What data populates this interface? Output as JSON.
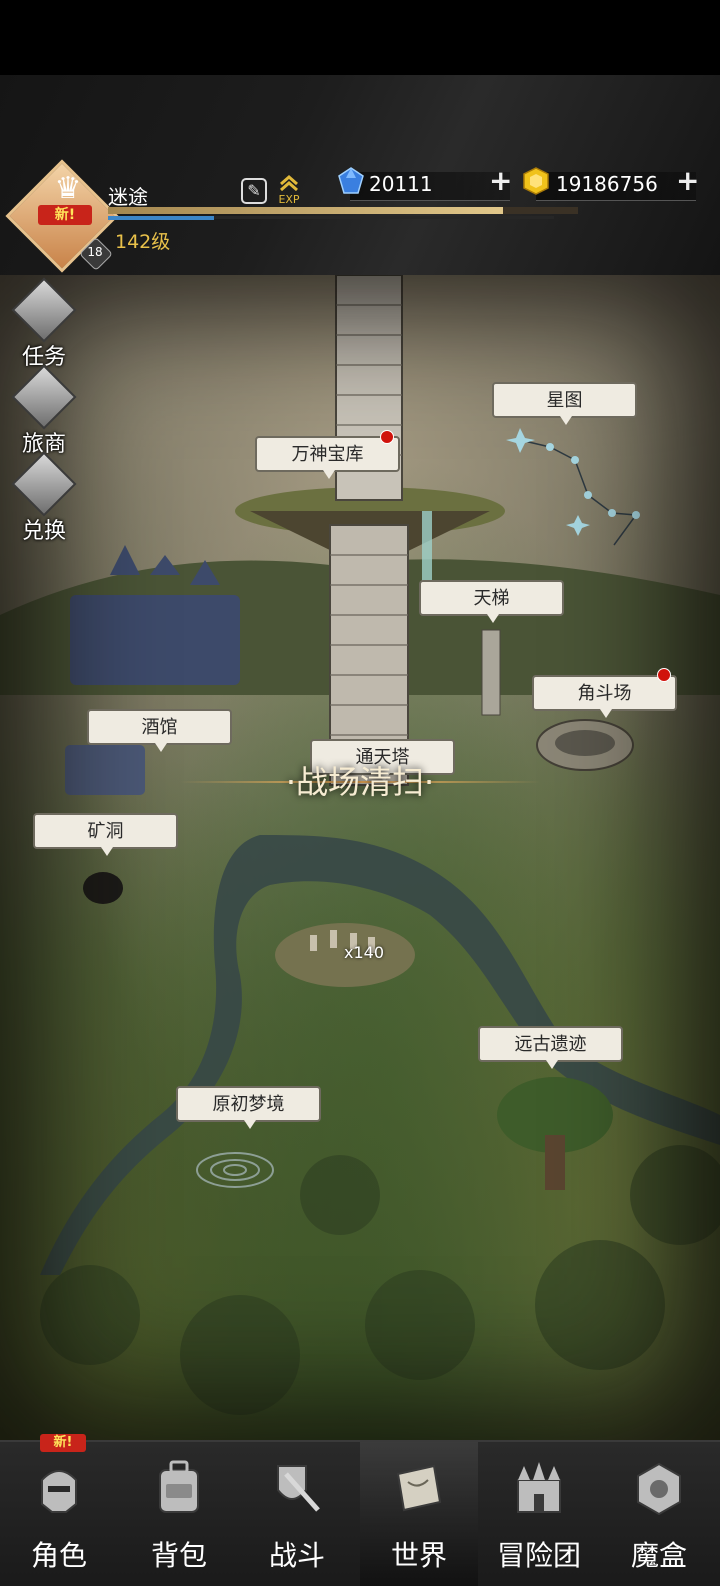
{
  "player": {
    "name": "迷途",
    "level_text": "142级",
    "vip": "18",
    "avatar_badge": "新!",
    "exp_icon_text": "EXP",
    "exp_progress": 0.84
  },
  "currency": {
    "gems": "20111",
    "gold": "19186756"
  },
  "side_menu": [
    {
      "label": "任务",
      "icon": "target-icon"
    },
    {
      "label": "旅商",
      "icon": "box-icon"
    },
    {
      "label": "兑换",
      "icon": "swap-icon"
    }
  ],
  "map_places": {
    "star_map": "星图",
    "pantheon_vault": "万神宝库",
    "sky_ladder": "天梯",
    "arena": "角斗场",
    "tavern": "酒馆",
    "sky_tower": "通天塔",
    "mine": "矿洞",
    "ancient_ruins": "远古遗迹",
    "origin_dream": "原初梦境"
  },
  "battle_sweep": "·战场清扫·",
  "stones_count": "x140",
  "bottom_nav": [
    {
      "label": "角色",
      "icon": "helmet-icon",
      "badge": "新!"
    },
    {
      "label": "背包",
      "icon": "backpack-icon"
    },
    {
      "label": "战斗",
      "icon": "sword-shield-icon"
    },
    {
      "label": "世界",
      "icon": "scroll-map-icon",
      "active": true
    },
    {
      "label": "冒险团",
      "icon": "castle-icon"
    },
    {
      "label": "魔盒",
      "icon": "magic-box-icon"
    }
  ],
  "colors": {
    "gold_text": "#e9c14a",
    "badge_red": "#c8241a",
    "gem_blue": "#3a7fe0",
    "coin_gold": "#f0c21b"
  }
}
